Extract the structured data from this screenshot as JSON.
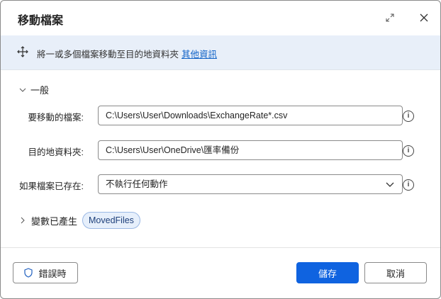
{
  "dialog": {
    "title": "移動檔案"
  },
  "banner": {
    "text": "將一或多個檔案移動至目的地資料夾",
    "link": "其他資訊"
  },
  "general": {
    "label": "一般",
    "fields": [
      {
        "label": "要移動的檔案:",
        "value": "C:\\Users\\User\\Downloads\\ExchangeRate*.csv"
      },
      {
        "label": "目的地資料夾:",
        "value": "C:\\Users\\User\\OneDrive\\匯率備份"
      },
      {
        "label": "如果檔案已存在:",
        "value": "不執行任何動作"
      }
    ],
    "info_glyph": "i"
  },
  "variables": {
    "label": "變數已產生",
    "chip": "MovedFiles"
  },
  "footer": {
    "on_error": "錯誤時",
    "save": "儲存",
    "cancel": "取消"
  },
  "colors": {
    "accent": "#0f63e0",
    "banner": "#e8eff9"
  }
}
